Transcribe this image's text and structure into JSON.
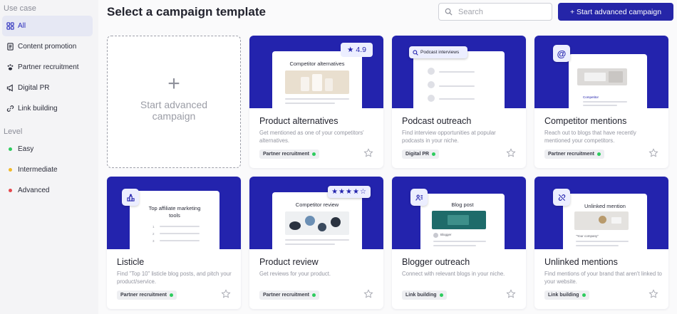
{
  "sidebar": {
    "use_case_heading": "Use case",
    "use_cases": [
      {
        "label": "All",
        "icon": "grid-icon",
        "active": true
      },
      {
        "label": "Content promotion",
        "icon": "document-icon"
      },
      {
        "label": "Partner recruitment",
        "icon": "paw-icon"
      },
      {
        "label": "Digital PR",
        "icon": "megaphone-icon"
      },
      {
        "label": "Link building",
        "icon": "link-icon"
      }
    ],
    "level_heading": "Level",
    "levels": [
      {
        "label": "Easy",
        "color": "#2ecc5e"
      },
      {
        "label": "Intermediate",
        "color": "#f2b928"
      },
      {
        "label": "Advanced",
        "color": "#e5484d"
      }
    ]
  },
  "header": {
    "title": "Select a campaign template",
    "search_placeholder": "Search",
    "advanced_button": "+ Start advanced campaign"
  },
  "new_card": {
    "label": "Start advanced campaign",
    "icon": "plus-icon"
  },
  "cards": [
    {
      "title": "Product alternatives",
      "desc": "Get mentioned as one of your competitors' alternatives.",
      "tag": "Partner recruitment",
      "window_title": "Competitor alternatives",
      "rating": "4.9"
    },
    {
      "title": "Podcast outreach",
      "desc": "Find interview opportunities at popular podcasts in your niche.",
      "tag": "Digital PR",
      "window_title": "Podcast interviews"
    },
    {
      "title": "Competitor mentions",
      "desc": "Reach out to blogs that have recently mentioned your competitors.",
      "tag": "Partner recruitment",
      "window_caption": "Competitor"
    },
    {
      "title": "Listicle",
      "desc": "Find \"Top 10\" listicle blog posts, and pitch your product/service.",
      "tag": "Partner recruitment",
      "window_title": "Top affiliate marketing tools"
    },
    {
      "title": "Product review",
      "desc": "Get reviews for your product.",
      "tag": "Partner recruitment",
      "window_title": "Competitor review",
      "stars": 4
    },
    {
      "title": "Blogger outreach",
      "desc": "Connect with relevant blogs in your niche.",
      "tag": "Link building",
      "window_title": "Blog post",
      "window_caption": "Blogger"
    },
    {
      "title": "Unlinked mentions",
      "desc": "Find mentions of your brand that aren't linked to your website.",
      "tag": "Link building",
      "window_title": "Unlinked mention",
      "window_caption": "\"Your company\""
    }
  ],
  "colors": {
    "accent": "#2323ad",
    "tag_dot": "#2ecc5e"
  }
}
